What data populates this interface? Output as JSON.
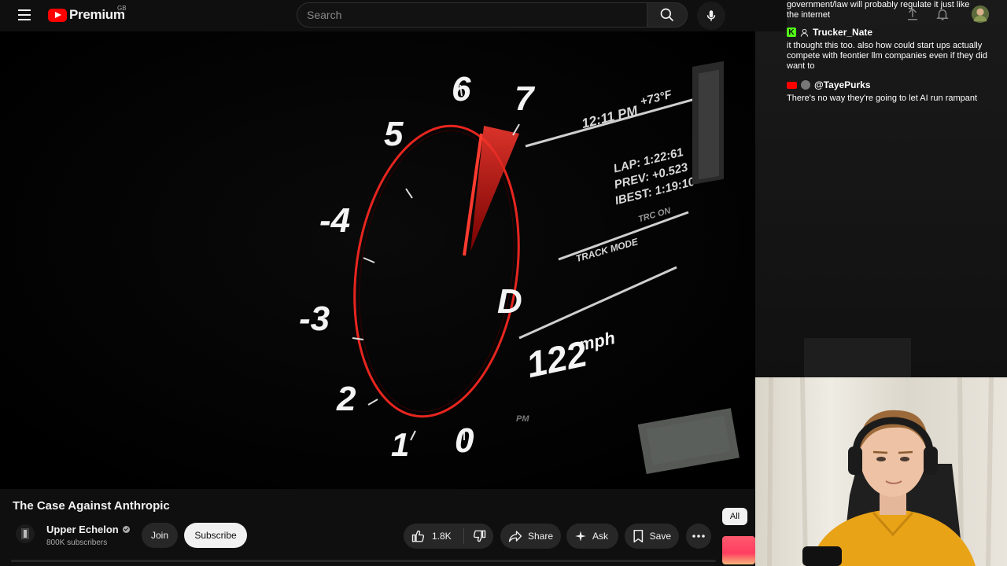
{
  "header": {
    "logo_text": "Premium",
    "country_code": "GB",
    "search_placeholder": "Search"
  },
  "video": {
    "title": "The Case Against Anthropic",
    "overlay": {
      "gauge_numbers": [
        "0",
        "1",
        "2",
        "-3",
        "-4",
        "5",
        "6",
        "7"
      ],
      "gear": "D",
      "speed": "122",
      "speed_unit": "mph",
      "time": "12:11 PM",
      "temperature": "+73°F",
      "lap": "LAP: 1:22:61",
      "prev": "PREV: +0.523",
      "best": "IBEST: 1:19:10",
      "mode": "TRACK MODE",
      "mode_state": "TRC ON",
      "rpm_label": "PM"
    }
  },
  "channel": {
    "name": "Upper Echelon",
    "subscribers": "800K subscribers",
    "join_label": "Join",
    "subscribe_label": "Subscribe"
  },
  "actions": {
    "likes": "1.8K",
    "share_label": "Share",
    "ask_label": "Ask",
    "save_label": "Save"
  },
  "chips": {
    "all_label": "All"
  },
  "chat": {
    "line1": "government/law will probably regulate it just like",
    "line2": "the internet",
    "messages": [
      {
        "author": "Trucker_Nate",
        "text": "it thought this too. also how could start ups actually compete with feontier llm companies even if they did want to"
      },
      {
        "author": "@TayePurks",
        "text": "There's no way they're going to let AI run rampant"
      }
    ]
  },
  "colors": {
    "accent_red": "#ff0000",
    "gauge_red": "#e8251f",
    "kick_green": "#53fc18",
    "webcam_shirt": "#e8a317"
  },
  "icons": [
    "menu-icon",
    "youtube-logo-icon",
    "search-icon",
    "mic-icon",
    "upload-icon",
    "bell-icon",
    "like-icon",
    "dislike-icon",
    "share-icon",
    "ask-sparkle-icon",
    "save-icon",
    "more-icon",
    "verified-icon"
  ]
}
